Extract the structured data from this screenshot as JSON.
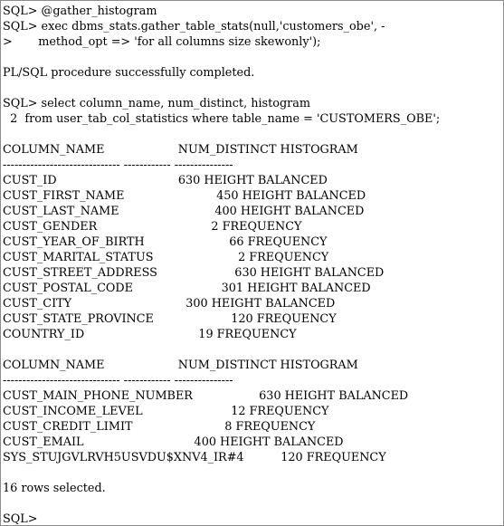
{
  "lines": [
    "SQL> @gather_histogram",
    "SQL> exec dbms_stats.gather_table_stats(null,'customers_obe', -",
    ">       method_opt => 'for all columns size skewonly');",
    "",
    "PL/SQL procedure successfully completed.",
    "",
    "SQL> select column_name, num_distinct, histogram",
    "  2  from user_tab_col_statistics where table_name = 'CUSTOMERS_OBE';",
    "",
    "COLUMN_NAME                    NUM_DISTINCT HISTOGRAM",
    "------------------------------ ------------ ---------------",
    "CUST_ID                                 630 HEIGHT BALANCED",
    "CUST_FIRST_NAME                         450 HEIGHT BALANCED",
    "CUST_LAST_NAME                          400 HEIGHT BALANCED",
    "CUST_GENDER                               2 FREQUENCY",
    "CUST_YEAR_OF_BIRTH                       66 FREQUENCY",
    "CUST_MARITAL_STATUS                       2 FREQUENCY",
    "CUST_STREET_ADDRESS                     630 HEIGHT BALANCED",
    "CUST_POSTAL_CODE                        301 HEIGHT BALANCED",
    "CUST_CITY                               300 HEIGHT BALANCED",
    "CUST_STATE_PROVINCE                     120 FREQUENCY",
    "COUNTRY_ID                               19 FREQUENCY",
    "",
    "COLUMN_NAME                    NUM_DISTINCT HISTOGRAM",
    "------------------------------ ------------ ---------------",
    "CUST_MAIN_PHONE_NUMBER                  630 HEIGHT BALANCED",
    "CUST_INCOME_LEVEL                        12 FREQUENCY",
    "CUST_CREDIT_LIMIT                         8 FREQUENCY",
    "CUST_EMAIL                              400 HEIGHT BALANCED",
    "SYS_STUJGVLRVH5USVDU$XNV4_IR#4          120 FREQUENCY",
    "",
    "16 rows selected.",
    "",
    "SQL>"
  ]
}
